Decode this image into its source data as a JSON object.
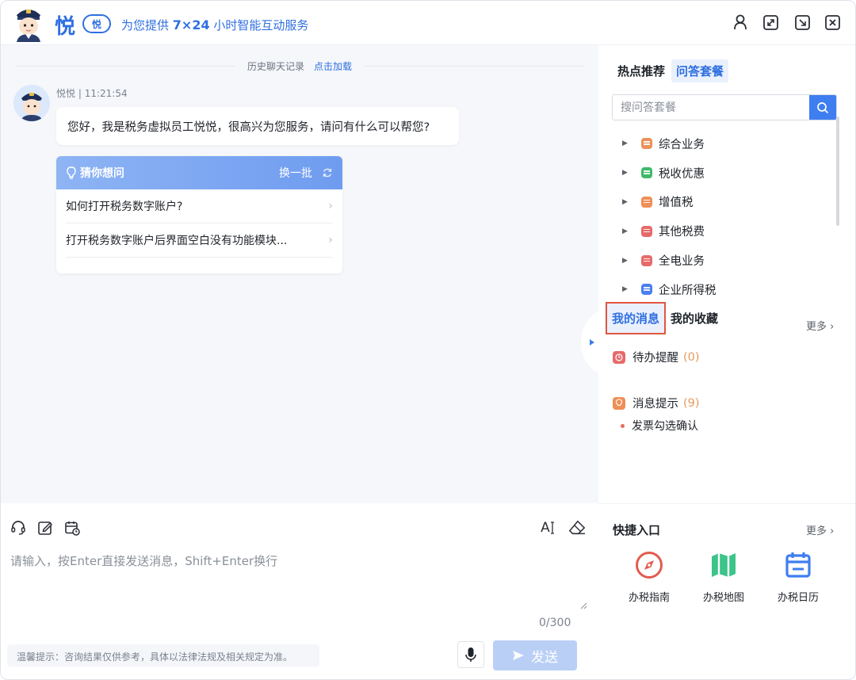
{
  "header": {
    "brand_char": "悦",
    "brand_badge": "悦",
    "slogan_prefix": "为您提供",
    "slogan_hours": "7×24",
    "slogan_suffix": "小时智能互动服务"
  },
  "chat": {
    "history_label": "历史聊天记录",
    "history_link": "点击加载",
    "sender": "悦悦",
    "time": "11:21:54",
    "greeting": "您好，我是税务虚拟员工悦悦，很高兴为您服务，请问有什么可以帮您?",
    "guess": {
      "title": "猜你想问",
      "swap_label": "换一批",
      "items": [
        {
          "text": "如何打开税务数字账户?"
        },
        {
          "text": "打开税务数字账户后界面空白没有功能模块..."
        }
      ]
    }
  },
  "input": {
    "placeholder": "请输入，按Enter直接发送消息，Shift+Enter换行",
    "counter": "0/300",
    "tip": "温馨提示：咨询结果仅供参考，具体以法律法规及相关规定为准。",
    "send_label": "发送",
    "font_size_label": "A"
  },
  "right": {
    "tab_hot": "热点推荐",
    "tab_qa": "问答套餐",
    "search_placeholder": "搜问答套餐",
    "categories": [
      {
        "label": "综合业务",
        "color": "#e9925a"
      },
      {
        "label": "税收优惠",
        "color": "#3fb96b"
      },
      {
        "label": "增值税",
        "color": "#ef8f57"
      },
      {
        "label": "其他税费",
        "color": "#e66a6a"
      },
      {
        "label": "全电业务",
        "color": "#e66a6a"
      },
      {
        "label": "企业所得税",
        "color": "#4a7ff0"
      }
    ],
    "tab_messages": "我的消息",
    "tab_favorites": "我的收藏",
    "more_label": "更多",
    "todo_label": "待办提醒",
    "todo_count": "(0)",
    "notice_label": "消息提示",
    "notice_count": "(9)",
    "notice_item": "发票勾选确认",
    "quick_title": "快捷入口",
    "quick_more": "更多",
    "quick_items": [
      {
        "label": "办税指南",
        "icon": "compass-icon",
        "color": "#e25c4f"
      },
      {
        "label": "办税地图",
        "icon": "map-icon",
        "color": "#3cc48a"
      },
      {
        "label": "办税日历",
        "icon": "calendar-icon",
        "color": "#3f7ef0"
      }
    ]
  },
  "colors": {
    "accent": "#2f6fe0",
    "highlight_border": "#e0563f"
  }
}
